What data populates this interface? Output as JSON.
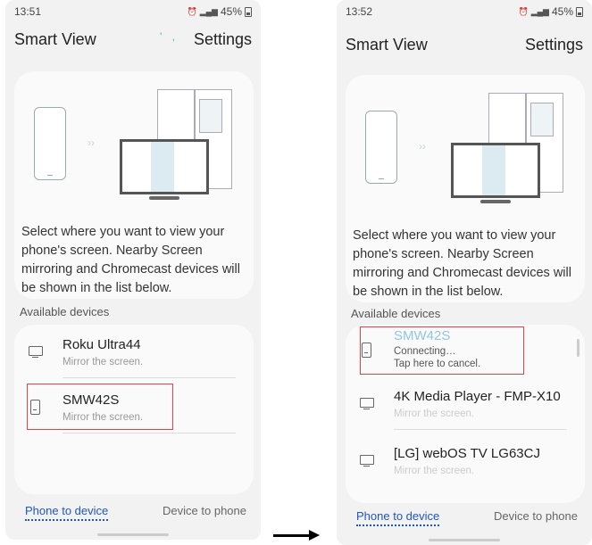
{
  "left": {
    "status": {
      "time": "13:51",
      "battery": "45%"
    },
    "header": {
      "title": "Smart View",
      "loading": "' ,",
      "settings": "Settings"
    },
    "description": "Select where you want to view your phone's screen. Nearby Screen mirroring and Chromecast devices will be shown in the list below.",
    "devices_label": "Available devices",
    "devices": [
      {
        "name": "Roku Ultra44",
        "sub": "Mirror the screen.",
        "icon": "monitor-icon"
      },
      {
        "name": "SMW42S",
        "sub": "Mirror the screen.",
        "icon": "phone-icon",
        "highlighted": true
      }
    ],
    "tabs": {
      "phone_to_device": "Phone to device",
      "device_to_phone": "Device to phone"
    }
  },
  "right": {
    "status": {
      "time": "13:52",
      "battery": "45%"
    },
    "header": {
      "title": "Smart View",
      "settings": "Settings"
    },
    "description": "Select where you want to view your phone's screen. Nearby Screen mirroring and Chromecast devices will be shown in the list below.",
    "devices_label": "Available devices",
    "devices": [
      {
        "name": "SMW42S",
        "sub": "Connecting…",
        "sub2": "Tap here to cancel.",
        "icon": "phone-icon",
        "highlighted": true,
        "state": "connecting"
      },
      {
        "name": "4K Media Player - FMP-X10",
        "sub": "Mirror the screen.",
        "icon": "monitor-icon"
      },
      {
        "name": "[LG] webOS TV LG63CJ",
        "sub": "Mirror the screen.",
        "icon": "monitor-icon"
      }
    ],
    "tabs": {
      "phone_to_device": "Phone to device",
      "device_to_phone": "Device to phone"
    }
  },
  "colors": {
    "accent_blue": "#1f56c2",
    "highlight_red": "#dd4444",
    "connecting_blue": "#8fc6e6"
  }
}
